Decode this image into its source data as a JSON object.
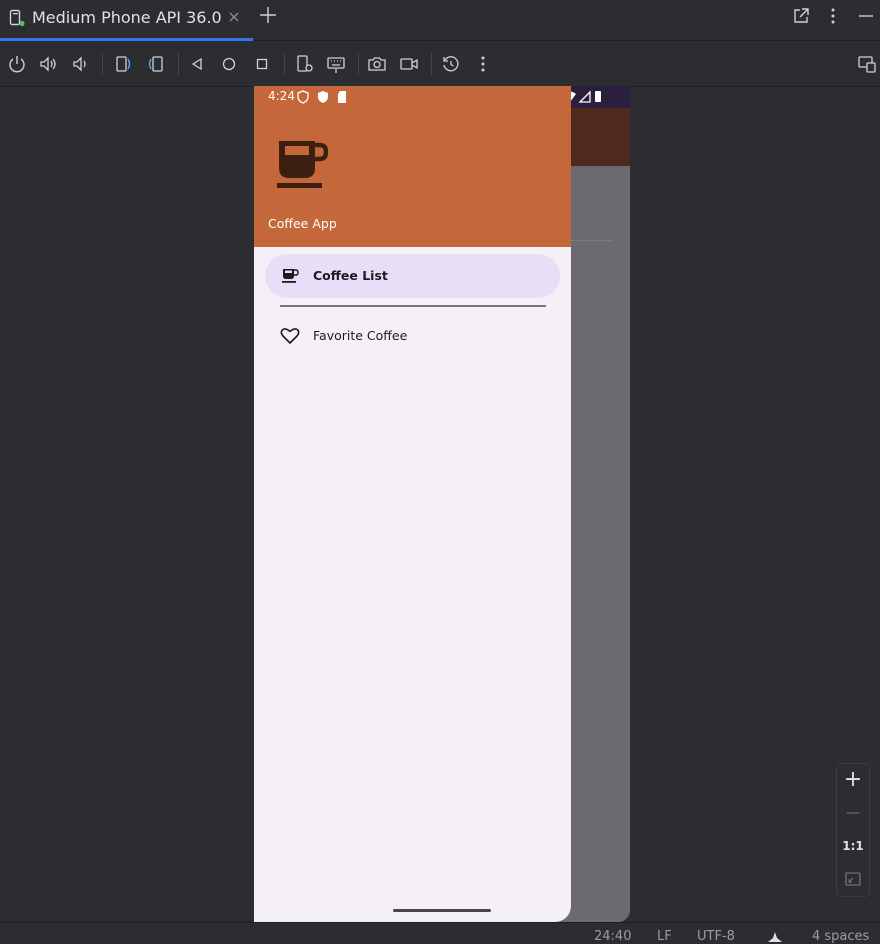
{
  "window": {
    "tab_title": "Medium Phone API 36.0",
    "icons": [
      "device-icon",
      "close-icon",
      "add-icon",
      "open-external-icon",
      "more-icon",
      "minimize-icon"
    ]
  },
  "toolbar": {
    "icons": [
      "power-icon",
      "volume-up-icon",
      "volume-down-icon",
      "rotate-left-icon",
      "rotate-right-icon",
      "back-icon",
      "home-icon",
      "overview-icon",
      "device-settings-icon",
      "keyboard-icon",
      "screenshot-icon",
      "screen-record-icon",
      "snapshot-restore-icon",
      "more-icon",
      "device-mirror-icon"
    ]
  },
  "device": {
    "status": {
      "time": "4:24"
    },
    "drawer": {
      "app_name": "Coffee App",
      "items": [
        {
          "label": "Coffee List",
          "icon": "coffee-cup-icon",
          "selected": true
        },
        {
          "label": "Favorite Coffee",
          "icon": "heart-outline-icon",
          "selected": false
        }
      ]
    },
    "colors": {
      "drawer_header": "#c4683c",
      "app_bar": "#4e2a1e",
      "drawer_bg": "#f5f0f7",
      "selected_item": "#e8def8",
      "cup_icon": "#3d1f12"
    }
  },
  "zoom": {
    "zoom_in": "+",
    "zoom_out": "—",
    "ratio": "1:1",
    "fit_icon": "fit-screen-icon"
  },
  "status_bar": {
    "position": "24:40",
    "line_ending": "LF",
    "encoding": "UTF-8",
    "indent": "4 spaces"
  }
}
